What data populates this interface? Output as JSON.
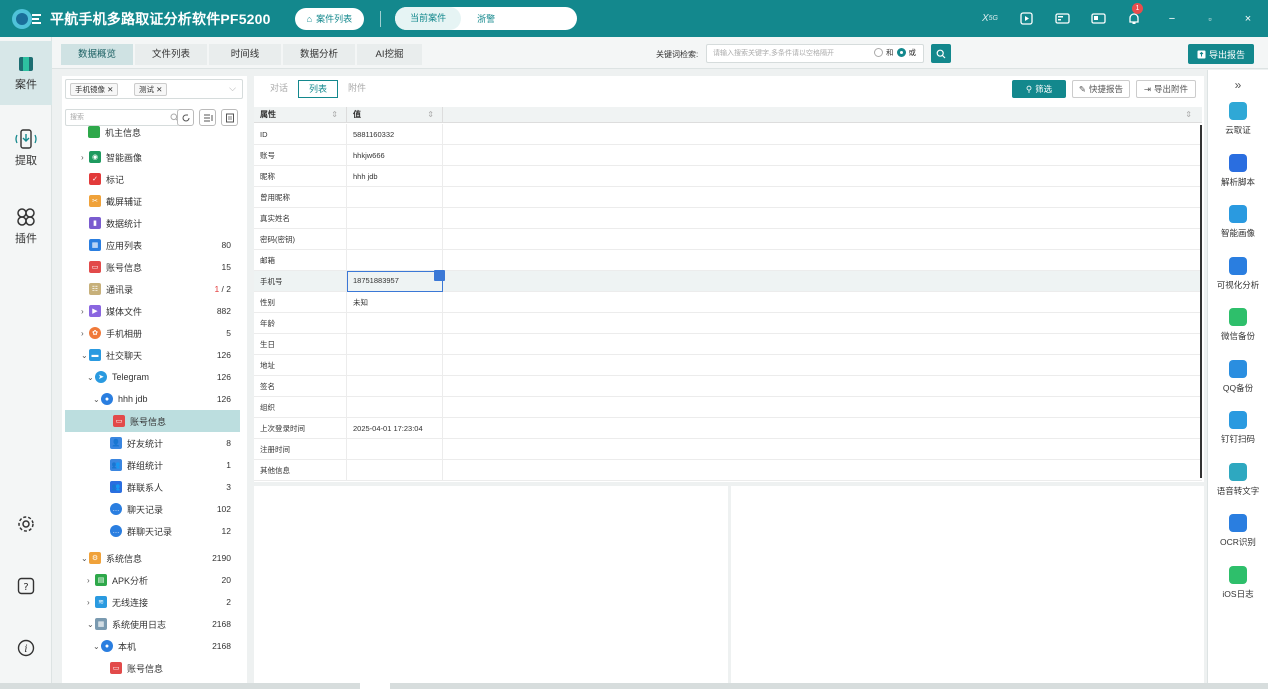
{
  "app": {
    "title": "平航手机多路取证分析软件PF5200",
    "case_list_label": "案件列表",
    "current_case_label": "当前案件",
    "current_case_value": "浙警",
    "notification_count": "1"
  },
  "rail": {
    "case": "案件",
    "extract": "提取",
    "plugin": "插件"
  },
  "tabs": [
    "数据概览",
    "文件列表",
    "时间线",
    "数据分析",
    "AI挖掘"
  ],
  "keyword": {
    "label": "关键词检索:",
    "placeholder": "请输入搜索关键字,多条件请以空格隔开",
    "and": "和",
    "or": "或"
  },
  "export_report": "导出报告",
  "tree": {
    "tags": [
      "手机镜像",
      "测试"
    ],
    "search_placeholder": "搜索",
    "nodes": [
      {
        "label": "机主信息",
        "count": ""
      },
      {
        "label": "智能画像",
        "count": ""
      },
      {
        "label": "标记",
        "count": ""
      },
      {
        "label": "截屏辅证",
        "count": ""
      },
      {
        "label": "数据统计",
        "count": ""
      },
      {
        "label": "应用列表",
        "count": "80"
      },
      {
        "label": "账号信息",
        "count": "15"
      },
      {
        "label": "通讯录",
        "count": "1 / 2"
      },
      {
        "label": "媒体文件",
        "count": "882"
      },
      {
        "label": "手机相册",
        "count": "5"
      },
      {
        "label": "社交聊天",
        "count": "126"
      },
      {
        "label": "Telegram",
        "count": "126"
      },
      {
        "label": "hhh jdb",
        "count": "126"
      },
      {
        "label": "账号信息",
        "count": ""
      },
      {
        "label": "好友统计",
        "count": "8"
      },
      {
        "label": "群组统计",
        "count": "1"
      },
      {
        "label": "群联系人",
        "count": "3"
      },
      {
        "label": "聊天记录",
        "count": "102"
      },
      {
        "label": "群聊天记录",
        "count": "12"
      },
      {
        "label": "系统信息",
        "count": "2190"
      },
      {
        "label": "APK分析",
        "count": "20"
      },
      {
        "label": "无线连接",
        "count": "2"
      },
      {
        "label": "系统使用日志",
        "count": "2168"
      },
      {
        "label": "本机",
        "count": "2168"
      },
      {
        "label": "账号信息",
        "count": ""
      }
    ]
  },
  "view_tabs": [
    "对话",
    "列表",
    "附件"
  ],
  "actions": {
    "filter": "筛选",
    "quick_report": "快捷报告",
    "export_attachment": "导出附件"
  },
  "table": {
    "headers": [
      "属性",
      "值"
    ],
    "rows": [
      {
        "k": "ID",
        "v": "5881160332"
      },
      {
        "k": "账号",
        "v": "hhkjw666"
      },
      {
        "k": "昵称",
        "v": "hhh jdb"
      },
      {
        "k": "曾用昵称",
        "v": ""
      },
      {
        "k": "真实姓名",
        "v": ""
      },
      {
        "k": "密码(密钥)",
        "v": ""
      },
      {
        "k": "邮箱",
        "v": ""
      },
      {
        "k": "手机号",
        "v": "18751883957"
      },
      {
        "k": "性别",
        "v": "未知"
      },
      {
        "k": "年龄",
        "v": ""
      },
      {
        "k": "生日",
        "v": ""
      },
      {
        "k": "地址",
        "v": ""
      },
      {
        "k": "签名",
        "v": ""
      },
      {
        "k": "组织",
        "v": ""
      },
      {
        "k": "上次登录时间",
        "v": "2025-04-01 17:23:04"
      },
      {
        "k": "注册时间",
        "v": ""
      },
      {
        "k": "其他信息",
        "v": ""
      }
    ]
  },
  "tools": [
    "云取证",
    "解析脚本",
    "智能画像",
    "可视化分析",
    "微信备份",
    "QQ备份",
    "钉钉扫码",
    "语音转文字",
    "OCR识别",
    "iOS日志"
  ],
  "colors": {
    "accent": "#13888d",
    "selection": "#bcdedf",
    "edit_border": "#3b78d6"
  }
}
